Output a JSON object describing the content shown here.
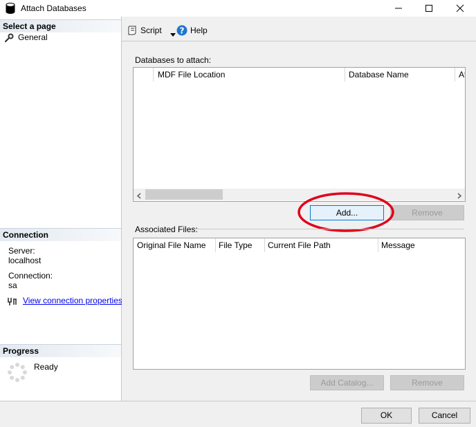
{
  "window": {
    "title": "Attach Databases"
  },
  "left": {
    "select_page_header": "Select a page",
    "pages": [
      {
        "label": "General",
        "icon": "wrench-icon"
      }
    ],
    "connection_header": "Connection",
    "server_label": "Server:",
    "server_value": "localhost",
    "connection_label": "Connection:",
    "connection_value": "sa",
    "view_props_link": "View connection properties",
    "progress_header": "Progress",
    "progress_status": "Ready"
  },
  "toolbar": {
    "script_label": "Script",
    "help_label": "Help"
  },
  "databases": {
    "label": "Databases to attach:",
    "columns": [
      "MDF File Location",
      "Database Name",
      "At"
    ],
    "rows": [],
    "add_button": "Add...",
    "remove_button": "Remove"
  },
  "associated": {
    "label": "Associated Files:",
    "columns": [
      "Original File Name",
      "File Type",
      "Current File Path",
      "Message"
    ],
    "rows": [],
    "add_catalog_button": "Add Catalog...",
    "remove_button": "Remove"
  },
  "footer": {
    "ok_button": "OK",
    "cancel_button": "Cancel"
  },
  "colors": {
    "highlight_ellipse": "#e0001b",
    "focus_border": "#0078d7",
    "link": "#0000ee"
  }
}
